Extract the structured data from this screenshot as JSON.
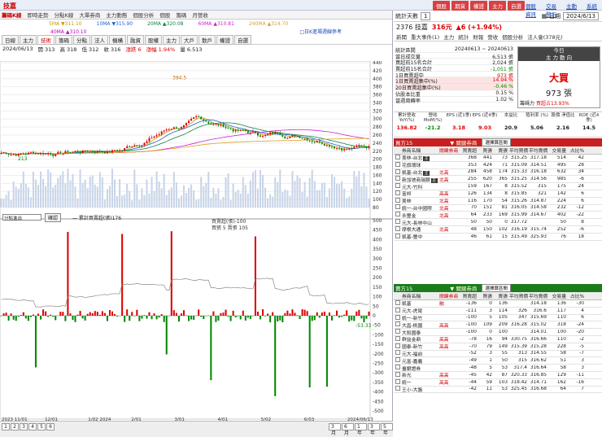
{
  "app": {
    "title": "技嘉"
  },
  "topbar": {
    "buttons": [
      "個股",
      "期貨",
      "權證",
      "主力",
      "自選"
    ],
    "links": [
      "個股資訊",
      "交易警示",
      "主動解析",
      "系統設定"
    ]
  },
  "left": {
    "tabs": [
      "籌碼K線",
      "即時走勢",
      "分點K線",
      "大單券商",
      "主力動態",
      "個股分析",
      "個股",
      "籌碼",
      "月營收"
    ],
    "ma": [
      "5MA ▼311.10",
      "10MA ▼315.90",
      "20MA ▲320.08",
      "60MA ▲310.81",
      "240MA ▲314.70"
    ],
    "ma2": "40MA ▲310.10",
    "ma_note": "□日K進場週線參考",
    "tabs2": [
      "日線",
      "主力",
      "技術",
      "籌碼",
      "分點",
      "法人",
      "機構",
      "融資",
      "股權",
      "主力",
      "大戶",
      "散戶",
      "權證",
      "自選"
    ],
    "info": {
      "date": "2024/06/13",
      "open": "開 313",
      "high": "高 318",
      "low": "低 312",
      "close": "收 316",
      "chg": "漲跌 6",
      "pct": "漲幅 1.94%",
      "vol": "量 6.513"
    },
    "peak": "394.5",
    "low_mark": "213",
    "price_ticks": [
      "440",
      "420",
      "400",
      "380",
      "360",
      "340",
      "320",
      "300",
      "280",
      "260",
      "240",
      "220",
      "200",
      "180",
      "160",
      "140",
      "120",
      "100",
      "80"
    ],
    "vol_note": "— 累計買賣超(張)176",
    "sub_sel": "分點進出",
    "sub_btn": "確認",
    "sub_note": "買賣超(張)-100",
    "sub_note2": "買張 5 賣張 105",
    "sub_ticks": [
      "500",
      "450",
      "400",
      "350",
      "300",
      "250",
      "200",
      "150",
      "100",
      "50",
      "0",
      "-50",
      "-100",
      "-150",
      "-200",
      "-250",
      "-300",
      "-350",
      "-400",
      "-450",
      "-500"
    ],
    "sub_last": "-53.33",
    "dates": [
      "2023 11/01",
      "12/01",
      "1/02 2024",
      "2/01",
      "3/01",
      "4/01",
      "5/02",
      "6/03",
      "2024/06/13"
    ],
    "pages": [
      "1",
      "2",
      "3",
      "4",
      "5",
      "6"
    ],
    "ranges": [
      "3月",
      "6月",
      "1年",
      "3年",
      "5年"
    ]
  },
  "right": {
    "period_label": "統計天數",
    "period_val": "1",
    "date_label": "日期",
    "date_val": "2024/6/13",
    "stock": {
      "code_name": "2376 技嘉",
      "price": "316元",
      "chg": "▲6 (+1.94%)"
    },
    "subtabs": [
      "新聞",
      "重大事件(1)",
      "主力",
      "統計",
      "財報",
      "營收",
      "個股分析",
      "法人會(378元)"
    ],
    "summary": [
      {
        "k": "統計區間",
        "v": "20240613 ~ 20240613",
        "c": ""
      },
      {
        "k": "當日成交量",
        "v": "6,513 張",
        "c": ""
      },
      {
        "k": "買超前15名合計",
        "v": "2,024 張",
        "c": ""
      },
      {
        "k": "賣超前15名合計",
        "v": "-1,051 張",
        "c": "green"
      },
      {
        "k": "1日買賣超中",
        "v": "973 張",
        "c": "red"
      },
      {
        "k": "1日買賣超集中(%)",
        "v": "14.94 %",
        "c": "red",
        "hl": true
      },
      {
        "k": "20日買賣超集中(%)",
        "v": "-0.46 %",
        "c": "green",
        "hl": true
      },
      {
        "k": "佔股本比重",
        "v": "0.15 %",
        "c": ""
      },
      {
        "k": "當週周轉率",
        "v": "1.02 %",
        "c": ""
      }
    ],
    "main": {
      "h1": "今日",
      "h2": "主 力 動 向",
      "big": "大買",
      "qty": "973 張",
      "foot_k": "籌碼力",
      "foot_v": "買超占13.93%"
    },
    "metrics": [
      {
        "l": "累計營收 YoY(%)",
        "v": "136.82",
        "c": "red"
      },
      {
        "l": "營收 MoM(%)",
        "v": "-21.2",
        "c": "green"
      },
      {
        "l": "EPS (近1季)",
        "v": "3.18",
        "c": "red"
      },
      {
        "l": "EPS (近4季)",
        "v": "9.03",
        "c": "red"
      },
      {
        "l": "本益比",
        "v": "20.9",
        "c": ""
      },
      {
        "l": "殖利率 (%)",
        "v": "5.06",
        "c": ""
      },
      {
        "l": "股價 淨值比",
        "v": "2.16",
        "c": ""
      },
      {
        "l": "ROE (近4季)",
        "v": "14.5",
        "c": ""
      }
    ],
    "buy_head": {
      "title": "買方15",
      "tool": "▼ 關鍵券商",
      "sel": "選擇算區間"
    },
    "sell_head": {
      "title": "賣方15",
      "tool": "▼ 關鍵券商",
      "sel": "選擇算區間"
    },
    "cols": [
      "",
      "券商名稱",
      "關鍵券商",
      "買賣超",
      "買張",
      "賣張",
      "平均買價",
      "平均賣價",
      "交易量",
      "占比%"
    ],
    "buys": [
      [
        "美林-台北",
        "",
        "368",
        "441",
        "73",
        "315.25",
        "317.18",
        "514",
        "42",
        "主"
      ],
      [
        "花旗環球",
        "",
        "353",
        "424",
        "71",
        "315.09",
        "314.51",
        "495",
        "28",
        ""
      ],
      [
        "凱基-台北",
        "北高",
        "284",
        "458",
        "174",
        "315.33",
        "316.18",
        "632",
        "34",
        "主"
      ],
      [
        "新加坡商瑞銀",
        "北高",
        "255",
        "620",
        "365",
        "315.25",
        "314.56",
        "985",
        "-6",
        "主"
      ],
      [
        "元大-竹科",
        "",
        "159",
        "167",
        "8",
        "315.52",
        "315",
        "175",
        "24",
        ""
      ],
      [
        "富邦",
        "高高",
        "126",
        "134",
        "8",
        "315.85",
        "321",
        "142",
        "6",
        ""
      ],
      [
        "美林",
        "北高",
        "116",
        "170",
        "54",
        "315.26",
        "314.87",
        "224",
        "6",
        ""
      ],
      [
        "統一-台中國際",
        "北高",
        "70",
        "151",
        "81",
        "316.05",
        "314.58",
        "232",
        "-12",
        ""
      ],
      [
        "永豐金",
        "北高",
        "64",
        "233",
        "169",
        "315.99",
        "314.67",
        "402",
        "-22",
        ""
      ],
      [
        "元大-長林中山",
        "",
        "50",
        "50",
        "0",
        "317.72",
        "",
        "50",
        "8",
        ""
      ],
      [
        "摩根大通",
        "北高",
        "48",
        "150",
        "102",
        "316.19",
        "315.74",
        "252",
        "-6",
        ""
      ],
      [
        "凱基-豐中",
        "",
        "46",
        "61",
        "15",
        "315.49",
        "325.93",
        "76",
        "18",
        ""
      ]
    ],
    "sells": [
      [
        "凱基",
        "融",
        "-136",
        "0",
        "136",
        "",
        "314.18",
        "136",
        "-30"
      ],
      [
        "元大-虎尾",
        "",
        "-111",
        "3",
        "114",
        "326",
        "316.6",
        "117",
        "4"
      ],
      [
        "統一-新竹",
        "",
        "-100",
        "5",
        "105",
        "347",
        "315.69",
        "110",
        "6"
      ],
      [
        "大昌-桃園",
        "高高",
        "-100",
        "109",
        "209",
        "316.28",
        "315.02",
        "318",
        "-24"
      ],
      [
        "大和國泰",
        "",
        "-100",
        "0",
        "100",
        "",
        "314.01",
        "100",
        "-20"
      ],
      [
        "群益金鼎",
        "高高",
        "-78",
        "16",
        "94",
        "330.75",
        "316.66",
        "110",
        "-2"
      ],
      [
        "國泰-新竹",
        "高高",
        "-70",
        "79",
        "149",
        "315.39",
        "315.28",
        "228",
        "-5"
      ],
      [
        "元大-福前",
        "",
        "-52",
        "3",
        "55",
        "313",
        "314.55",
        "58",
        "-7"
      ],
      [
        "元富-嘉義",
        "",
        "-49",
        "1",
        "50",
        "315",
        "316.62",
        "51",
        "3"
      ],
      [
        "臺銀證券",
        "",
        "-48",
        "5",
        "53",
        "317.4",
        "316.64",
        "58",
        "3"
      ],
      [
        "新光",
        "高高",
        "-45",
        "42",
        "87",
        "320.33",
        "316.85",
        "129",
        "-11"
      ],
      [
        "統一",
        "高高",
        "-44",
        "59",
        "103",
        "318.42",
        "314.71",
        "162",
        "-16"
      ],
      [
        "王小-大盤",
        "",
        "-42",
        "11",
        "53",
        "325.45",
        "316.68",
        "64",
        "7"
      ]
    ]
  }
}
